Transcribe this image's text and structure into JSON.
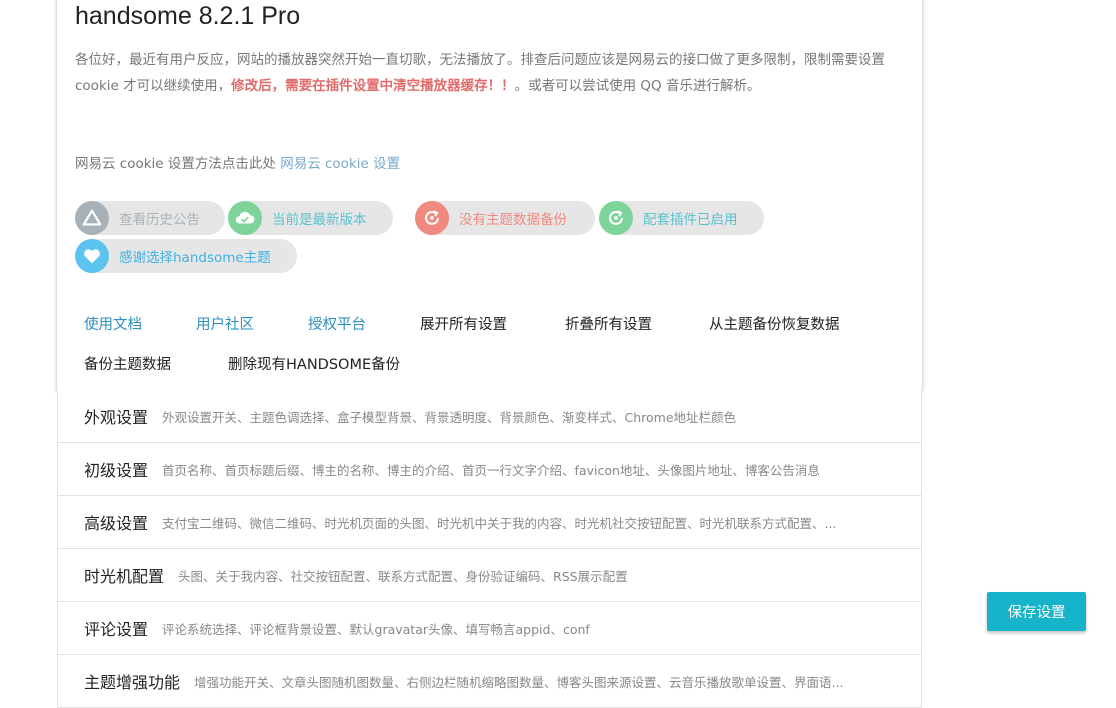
{
  "header": {
    "title": "handsome 8.2.1 Pro",
    "notice_part1": "各位好，最近有用户反应，网站的播放器突然开始一直切歌，无法播放了。排查后问题应该是网易云的接口做了更多限制，限制需要设置 cookie 才可以继续使用，",
    "notice_red": "修改后，需要在插件设置中清空播放器缓存！！",
    "notice_part2": "。或者可以尝试使用 QQ 音乐进行解析。",
    "cookie_text": "网易云 cookie 设置方法点击此处 ",
    "cookie_link": "网易云 cookie 设置"
  },
  "badges": [
    {
      "label": "查看历史公告",
      "icon": "warning-triangle-icon",
      "icon_color": "#a9b1b8",
      "text_color": "#aab4bb"
    },
    {
      "label": "当前是最新版本",
      "icon": "cloud-check-icon",
      "icon_color": "#7ed39a",
      "text_color": "#5bc2cf"
    },
    {
      "label": "没有主题数据备份",
      "icon": "backup-refresh-icon",
      "icon_color": "#f08a80",
      "text_color": "#f08a80"
    },
    {
      "label": "配套插件已启用",
      "icon": "refresh-icon",
      "icon_color": "#7ed39a",
      "text_color": "#5bc2cf"
    },
    {
      "label": "感谢选择handsome主题",
      "icon": "heart-icon",
      "icon_color": "#5cc3ee",
      "text_color": "#3fb2e3"
    }
  ],
  "links": {
    "docs": "使用文档",
    "community": "用户社区",
    "license": "授权平台",
    "expand_all": "展开所有设置",
    "collapse_all": "折叠所有设置",
    "restore": "从主题备份恢复数据",
    "backup": "备份主题数据",
    "delete_backup": "删除现有HANDSOME备份"
  },
  "sections": [
    {
      "name": "外观设置",
      "desc": "外观设置开关、主题色调选择、盒子模型背景、背景透明度、背景颜色、渐变样式、Chrome地址栏颜色"
    },
    {
      "name": "初级设置",
      "desc": "首页名称、首页标题后缀、博主的名称、博主的介绍、首页一行文字介绍、favicon地址、头像图片地址、博客公告消息"
    },
    {
      "name": "高级设置",
      "desc": "支付宝二维码、微信二维码、时光机页面的头图、时光机中关于我的内容、时光机社交按钮配置、时光机联系方式配置、..."
    },
    {
      "name": "时光机配置",
      "desc": "头图、关于我内容、社交按钮配置、联系方式配置、身份验证编码、RSS展示配置"
    },
    {
      "name": "评论设置",
      "desc": "评论系统选择、评论框背景设置、默认gravatar头像、填写畅言appid、conf"
    },
    {
      "name": "主题增强功能",
      "desc": "增强功能开关、文章头图随机图数量、右侧边栏随机缩略图数量、博客头图来源设置、云音乐播放歌单设置、界面语..."
    }
  ],
  "save_button": "保存设置"
}
